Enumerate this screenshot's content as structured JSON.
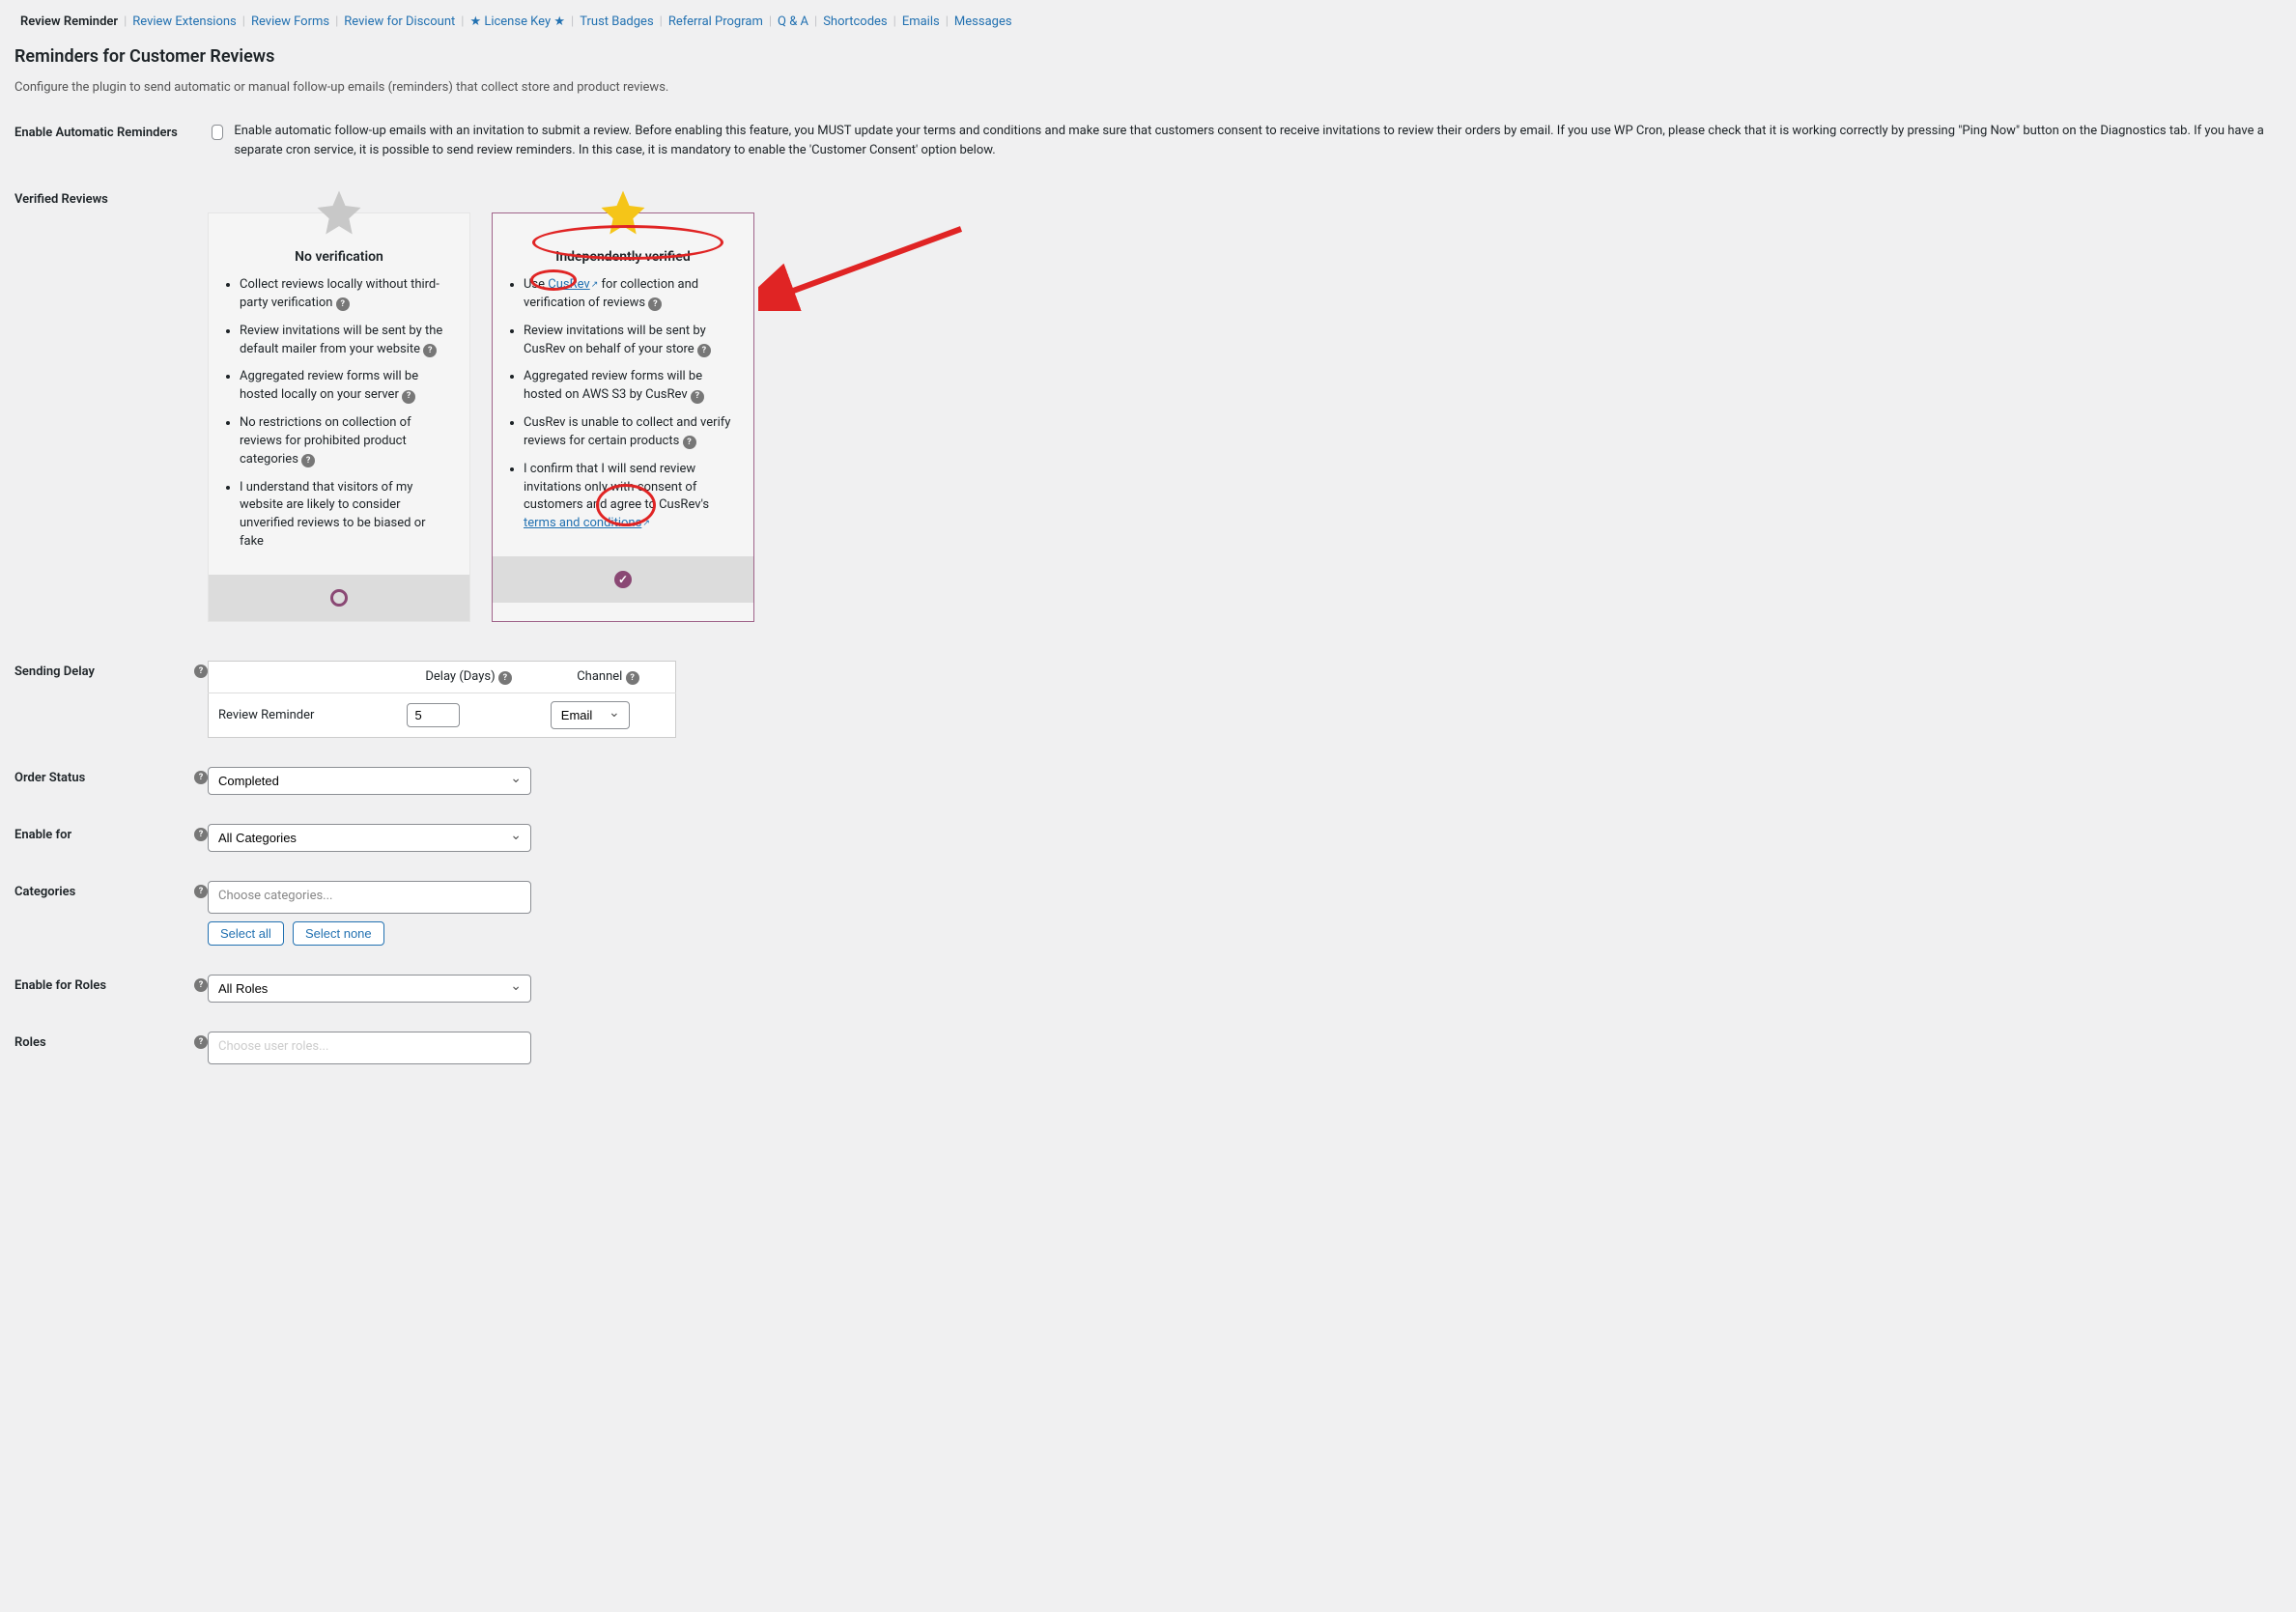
{
  "tabs": [
    {
      "label": "Review Reminder",
      "active": true
    },
    {
      "label": "Review Extensions"
    },
    {
      "label": "Review Forms"
    },
    {
      "label": "Review for Discount"
    },
    {
      "label": "★ License Key ★"
    },
    {
      "label": "Trust Badges"
    },
    {
      "label": "Referral Program"
    },
    {
      "label": "Q & A"
    },
    {
      "label": "Shortcodes"
    },
    {
      "label": "Emails"
    },
    {
      "label": "Messages"
    }
  ],
  "page": {
    "title": "Reminders for Customer Reviews",
    "desc": "Configure the plugin to send automatic or manual follow-up emails (reminders) that collect store and product reviews."
  },
  "enable_reminders": {
    "label": "Enable Automatic Reminders",
    "text": "Enable automatic follow-up emails with an invitation to submit a review. Before enabling this feature, you MUST update your terms and conditions and make sure that customers consent to receive invitations to review their orders by email. If you use WP Cron, please check that it is working correctly by pressing \"Ping Now\" button on the Diagnostics tab. If you have a separate cron service, it is possible to send review reminders. In this case, it is mandatory to enable the 'Customer Consent' option below."
  },
  "verified": {
    "label": "Verified Reviews",
    "card_a": {
      "title": "No verification",
      "items": [
        "Collect reviews locally without third-party verification",
        "Review invitations will be sent by the default mailer from your website",
        "Aggregated review forms will be hosted locally on your server",
        "No restrictions on collection of reviews for prohibited product categories",
        "I understand that visitors of my website are likely to consider unverified reviews to be biased or fake"
      ]
    },
    "card_b": {
      "title": "Independently verified",
      "item1_pre": "Use ",
      "item1_link": "CusRev",
      "item1_post": " for collection and verification of reviews",
      "item2": "Review invitations will be sent by CusRev on behalf of your store",
      "item3": "Aggregated review forms will be hosted on AWS S3 by CusRev",
      "item4": "CusRev is unable to collect and verify reviews for certain products",
      "item5_pre": "I confirm that I will send review invitations only with consent of customers and agree to CusRev's ",
      "item5_link": "terms and conditions"
    }
  },
  "delay": {
    "label": "Sending Delay",
    "col_delay": "Delay (Days)",
    "col_channel": "Channel",
    "row_name": "Review Reminder",
    "value": "5",
    "channel": "Email"
  },
  "order_status": {
    "label": "Order Status",
    "value": "Completed"
  },
  "enable_for": {
    "label": "Enable for",
    "value": "All Categories"
  },
  "categories": {
    "label": "Categories",
    "placeholder": "Choose categories...",
    "btn_all": "Select all",
    "btn_none": "Select none"
  },
  "roles": {
    "label": "Enable for Roles",
    "value": "All Roles"
  },
  "roles2": {
    "label": "Roles",
    "placeholder": "Choose user roles..."
  }
}
